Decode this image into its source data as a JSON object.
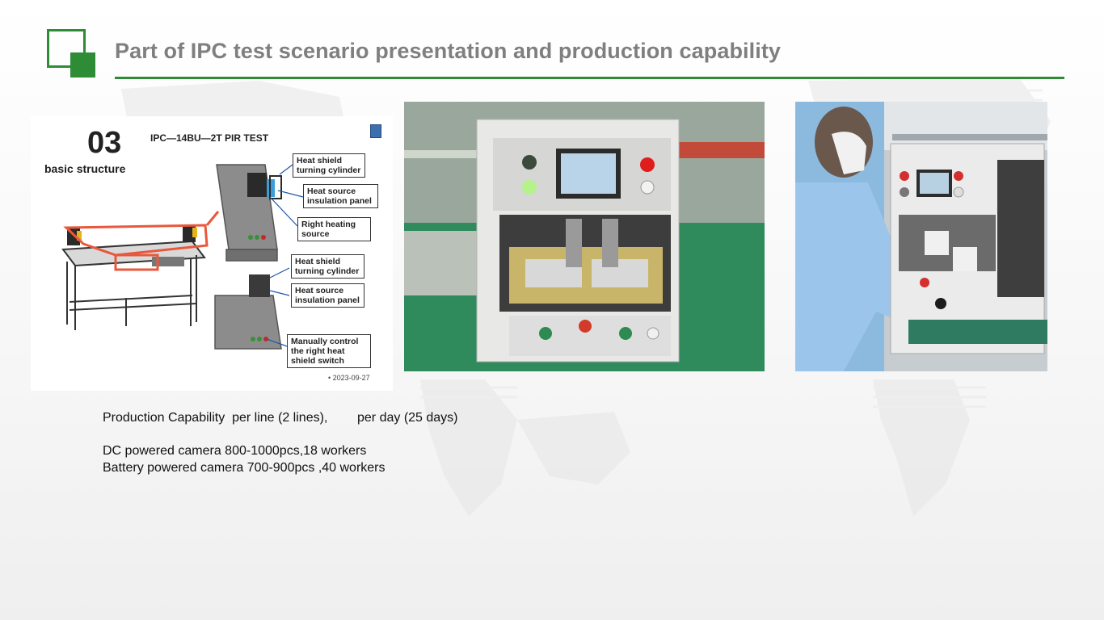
{
  "header": {
    "title": "Part of IPC test scenario presentation and production capability"
  },
  "diagram": {
    "number": "03",
    "subtitle": "basic structure",
    "title": "IPC—14BU—2T PIR TEST",
    "date": "• 2023-09-27",
    "callouts": [
      "Heat shield\nturning cylinder",
      "Heat source\ninsulation panel",
      "Right heating\nsource",
      "Heat shield\nturning cylinder",
      "Heat source\ninsulation panel",
      "Manually control\nthe right heat\nshield switch"
    ]
  },
  "capability": {
    "line1_a": "Production Capability  per line (2 lines),",
    "line1_b": "per day (25 days)",
    "line2": "DC powered camera 800-1000pcs,18 workers",
    "line3": "Battery powered camera 700-900pcs ,40 workers"
  },
  "colors": {
    "accent": "#2e8b36",
    "title_gray": "#7f7f7f",
    "highlight_red": "#e8583c"
  }
}
